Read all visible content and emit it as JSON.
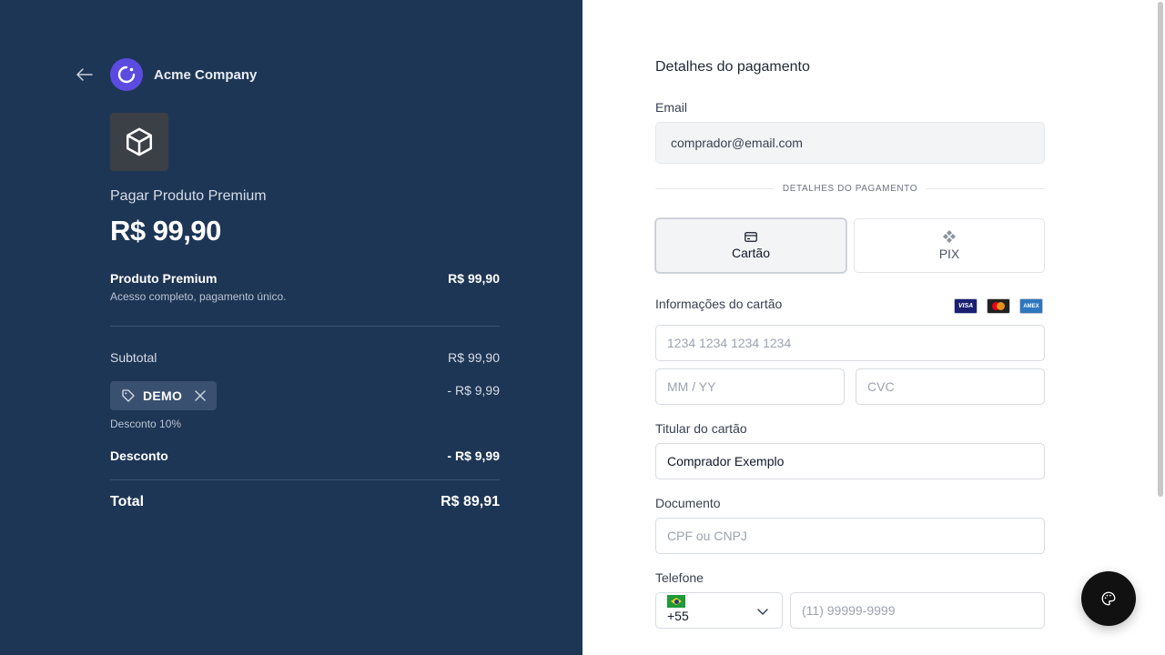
{
  "summary": {
    "company_name": "Acme Company",
    "pay_title": "Pagar Produto Premium",
    "pay_amount": "R$ 99,90",
    "item": {
      "name": "Produto Premium",
      "price": "R$ 99,90",
      "description": "Acesso completo, pagamento único."
    },
    "subtotal_label": "Subtotal",
    "subtotal_value": "R$ 99,90",
    "coupon": {
      "code": "DEMO",
      "amount": "- R$ 9,99",
      "note": "Desconto 10%"
    },
    "discount_label": "Desconto",
    "discount_value": "- R$ 9,99",
    "total_label": "Total",
    "total_value": "R$ 89,91"
  },
  "payment": {
    "section_title": "Detalhes do pagamento",
    "email_label": "Email",
    "email_value": "comprador@email.com",
    "separator_text": "DETALHES DO PAGAMENTO",
    "methods": [
      {
        "label": "Cartão",
        "icon": "credit-card-icon",
        "selected": true
      },
      {
        "label": "PIX",
        "icon": "pix-icon",
        "selected": false
      }
    ],
    "card_info_label": "Informações do cartão",
    "card_brands": [
      "VISA",
      "mastercard",
      "AMEX"
    ],
    "card_number_placeholder": "1234 1234 1234 1234",
    "expiry_placeholder": "MM / YY",
    "cvc_placeholder": "CVC",
    "holder_label": "Titular do cartão",
    "holder_value": "Comprador Exemplo",
    "document_label": "Documento",
    "document_placeholder": "CPF ou CNPJ",
    "phone_label": "Telefone",
    "phone_country_code": "+55",
    "phone_placeholder": "(11) 99999-9999"
  },
  "colors": {
    "left_bg": "#1e3655",
    "logo_accent": "#5b4be0",
    "fab_bg": "#111111"
  }
}
